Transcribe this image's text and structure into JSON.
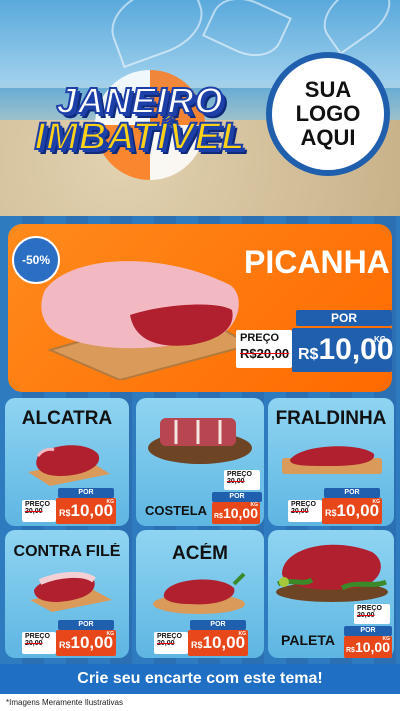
{
  "header": {
    "title_line1": "JANEIRO",
    "title_line2": "IMBATÍVEL",
    "logo_lines": [
      "SUA",
      "LOGO",
      "AQUI"
    ]
  },
  "featured": {
    "discount_badge": "-50%",
    "name": "PICANHA",
    "por_label": "POR",
    "preco_label": "PREÇO",
    "old_price": "R$20,00",
    "currency": "R$",
    "price": "10,00",
    "unit": "KG"
  },
  "products": [
    {
      "name": "ALCATRA",
      "preco_label": "PREÇO",
      "old_price": "20,00",
      "por_label": "POR",
      "currency": "R$",
      "price": "10,00",
      "unit": "KG"
    },
    {
      "name": "COSTELA",
      "preco_label": "PREÇO",
      "old_price": "20,00",
      "por_label": "POR",
      "currency": "R$",
      "price": "10,00",
      "unit": "KG"
    },
    {
      "name": "FRALDINHA",
      "preco_label": "PREÇO",
      "old_price": "20,00",
      "por_label": "POR",
      "currency": "R$",
      "price": "10,00",
      "unit": "KG"
    },
    {
      "name": "CONTRA FILÉ",
      "preco_label": "PREÇO",
      "old_price": "20,00",
      "por_label": "POR",
      "currency": "R$",
      "price": "10,00",
      "unit": "KG"
    },
    {
      "name": "ACÉM",
      "preco_label": "PREÇO",
      "old_price": "20,00",
      "por_label": "POR",
      "currency": "R$",
      "price": "10,00",
      "unit": "KG"
    },
    {
      "name": "PALETA",
      "preco_label": "PREÇO",
      "old_price": "20,00",
      "por_label": "POR",
      "currency": "R$",
      "price": "10,00",
      "unit": "KG"
    }
  ],
  "cta": {
    "label": "Crie seu encarte com este tema!"
  },
  "footer": {
    "note": "*Imagens Meramente Ilustrativas"
  },
  "colors": {
    "accent_orange": "#ff7a1a",
    "brand_blue": "#1f5fae",
    "price_red": "#e8471a",
    "card_blue": "#6cc0e8"
  }
}
